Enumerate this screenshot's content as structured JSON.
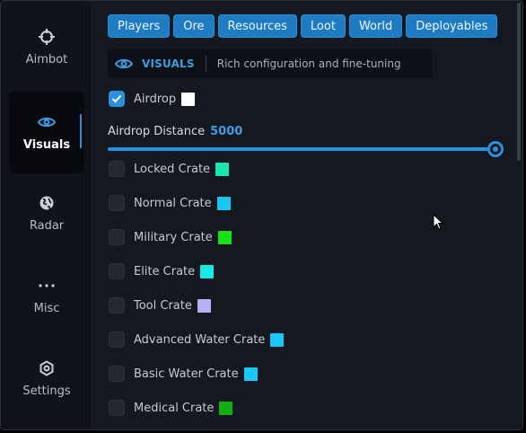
{
  "sidebar": {
    "items": [
      {
        "label": "Aimbot",
        "icon": "crosshair-icon"
      },
      {
        "label": "Visuals",
        "icon": "eye-icon",
        "active": true
      },
      {
        "label": "Radar",
        "icon": "globe-icon"
      },
      {
        "label": "Misc",
        "icon": "more-icon"
      },
      {
        "label": "Settings",
        "icon": "gear-icon"
      }
    ]
  },
  "tabs": [
    "Players",
    "Ore",
    "Resources",
    "Loot",
    "World",
    "Deployables"
  ],
  "header": {
    "icon": "eye-icon",
    "title": "VISUALS",
    "description": "Rich configuration and fine-tuning"
  },
  "airdrop": {
    "label": "Airdrop",
    "checked": true,
    "color": "#ffffff"
  },
  "slider": {
    "label": "Airdrop Distance",
    "value": "5000",
    "fraction": 1.0
  },
  "crates": [
    {
      "label": "Locked Crate",
      "checked": false,
      "color": "#18e8b0"
    },
    {
      "label": "Normal Crate",
      "checked": false,
      "color": "#18c8f0"
    },
    {
      "label": "Military Crate",
      "checked": false,
      "color": "#18e018"
    },
    {
      "label": "Elite Crate",
      "checked": false,
      "color": "#18e8e8"
    },
    {
      "label": "Tool Crate",
      "checked": false,
      "color": "#b8b0f0"
    },
    {
      "label": "Advanced Water Crate",
      "checked": false,
      "color": "#18c8f8"
    },
    {
      "label": "Basic Water Crate",
      "checked": false,
      "color": "#18c8f8"
    },
    {
      "label": "Medical Crate",
      "checked": false,
      "color": "#10b010"
    }
  ],
  "colors": {
    "accent": "#2a8fde",
    "background": "#141821",
    "sidebar": "#0f131b"
  }
}
